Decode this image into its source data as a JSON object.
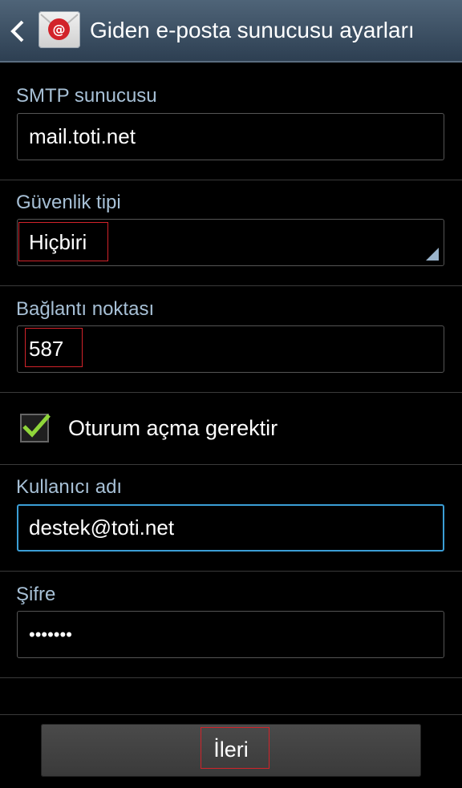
{
  "header": {
    "title": "Giden e-posta sunucusu ayarları",
    "back_icon": "chevron-left-icon",
    "app_icon": "email-app-icon",
    "app_icon_glyph": "@"
  },
  "smtp": {
    "label": "SMTP sunucusu",
    "value": "mail.toti.net"
  },
  "security": {
    "label": "Güvenlik tipi",
    "value": "Hiçbiri"
  },
  "port": {
    "label": "Bağlantı noktası",
    "value": "587"
  },
  "auth": {
    "label": "Oturum açma gerektir",
    "checked": true
  },
  "username": {
    "label": "Kullanıcı adı",
    "value": "destek@toti.net"
  },
  "password": {
    "label": "Şifre",
    "value": "•••••••"
  },
  "footer": {
    "next_label": "İleri"
  },
  "colors": {
    "label": "#a7c0d6",
    "focus_border": "#3b9ed6",
    "checkmark": "#8fd63a",
    "highlight_box": "#d2232a"
  }
}
